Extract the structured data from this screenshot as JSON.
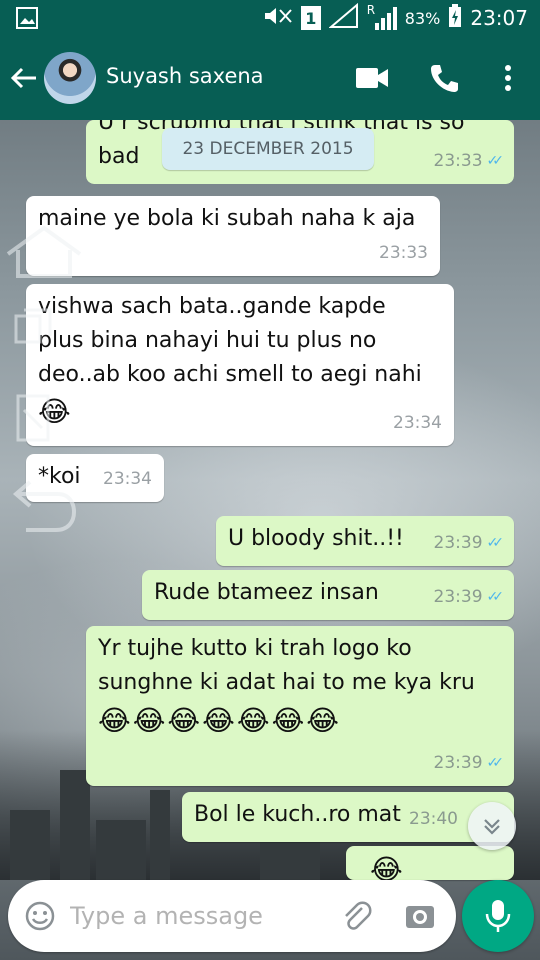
{
  "status_bar": {
    "sim_label": "1",
    "roaming": "R",
    "battery": "83%",
    "time": "23:07"
  },
  "header": {
    "contact_name": "Suyash saxena"
  },
  "date_chip": "23 DECEMBER 2015",
  "messages": [
    {
      "direction": "out",
      "text_line1": "U r scrubing that i stink that is so",
      "text_line2": "bad",
      "time": "23:33"
    },
    {
      "direction": "in",
      "text": "maine ye bola ki subah naha k aja",
      "time": "23:33"
    },
    {
      "direction": "in",
      "text_line1": "vishwa sach bata..gande kapde",
      "text_line2": "plus bina nahayi hui tu plus no",
      "text_line3": "deo..ab koo achi smell to aegi nahi",
      "emoji": "😂",
      "time": "23:34"
    },
    {
      "direction": "in",
      "text": "*koi",
      "time": "23:34"
    },
    {
      "direction": "out",
      "text": "U bloody shit..!!",
      "time": "23:39"
    },
    {
      "direction": "out",
      "text": "Rude btameez insan",
      "time": "23:39"
    },
    {
      "direction": "out",
      "text_line1": "Yr tujhe kutto ki trah logo ko",
      "text_line2": "sunghne ki adat hai to me kya kru",
      "emoji": "😂😂😂😂😂😂😂",
      "time": "23:39"
    },
    {
      "direction": "out",
      "text": "Bol le kuch..ro mat",
      "time": "23:40"
    },
    {
      "direction": "out",
      "emoji": "😂"
    }
  ],
  "composer": {
    "placeholder": "Type a message"
  },
  "colors": {
    "header": "#075e54",
    "outgoing_bubble": "#dcf8c6",
    "incoming_bubble": "#ffffff",
    "mic_button": "#00a884",
    "read_ticks": "#4fb6ec"
  },
  "icons": {
    "back": "arrow-left-icon",
    "video": "video-camera-icon",
    "call": "phone-icon",
    "more": "more-vertical-icon",
    "emoji": "smiley-icon",
    "attach": "paperclip-icon",
    "camera": "camera-icon",
    "mic": "microphone-icon",
    "scroll_down": "chevron-double-down-icon"
  }
}
